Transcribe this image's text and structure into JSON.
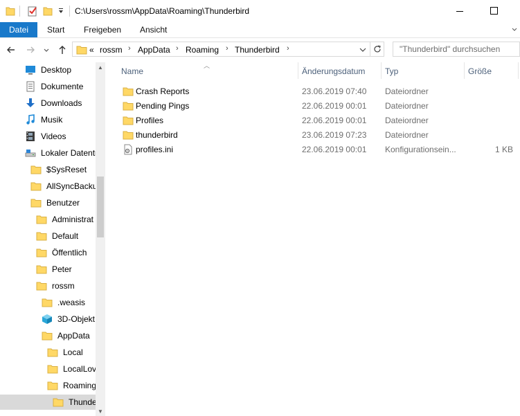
{
  "window": {
    "path": "C:\\Users\\rossm\\AppData\\Roaming\\Thunderbird"
  },
  "ribbon": {
    "tabs": [
      "Datei",
      "Start",
      "Freigeben",
      "Ansicht"
    ]
  },
  "address": {
    "overflow": "«",
    "crumbs": [
      "rossm",
      "AppData",
      "Roaming",
      "Thunderbird"
    ]
  },
  "search": {
    "placeholder": "\"Thunderbird\" durchsuchen"
  },
  "sidebar": {
    "items": [
      {
        "label": "Desktop",
        "icon": "desktop-icon"
      },
      {
        "label": "Dokumente",
        "icon": "documents-icon"
      },
      {
        "label": "Downloads",
        "icon": "download-arrow-icon"
      },
      {
        "label": "Musik",
        "icon": "music-note-icon"
      },
      {
        "label": "Videos",
        "icon": "film-icon"
      },
      {
        "label": "Lokaler Datentr",
        "icon": "drive-icon"
      },
      {
        "label": "$SysReset",
        "icon": "folder-icon"
      },
      {
        "label": "AllSyncBacku",
        "icon": "folder-icon"
      },
      {
        "label": "Benutzer",
        "icon": "folder-icon"
      },
      {
        "label": "Administrat",
        "icon": "folder-icon"
      },
      {
        "label": "Default",
        "icon": "folder-icon"
      },
      {
        "label": "Öffentlich",
        "icon": "folder-icon"
      },
      {
        "label": "Peter",
        "icon": "folder-icon"
      },
      {
        "label": "rossm",
        "icon": "folder-icon"
      },
      {
        "label": ".weasis",
        "icon": "folder-icon"
      },
      {
        "label": "3D-Objekt",
        "icon": "3d-objects-icon"
      },
      {
        "label": "AppData",
        "icon": "folder-icon"
      },
      {
        "label": "Local",
        "icon": "folder-icon"
      },
      {
        "label": "LocalLov",
        "icon": "folder-icon"
      },
      {
        "label": "Roaming",
        "icon": "folder-icon"
      },
      {
        "label": "Thunde",
        "icon": "folder-icon"
      }
    ]
  },
  "columns": {
    "name": "Name",
    "date": "Änderungsdatum",
    "type": "Typ",
    "size": "Größe"
  },
  "files": [
    {
      "name": "Crash Reports",
      "date": "23.06.2019 07:40",
      "type": "Dateiordner",
      "size": "",
      "icon": "folder-icon"
    },
    {
      "name": "Pending Pings",
      "date": "22.06.2019 00:01",
      "type": "Dateiordner",
      "size": "",
      "icon": "folder-icon"
    },
    {
      "name": "Profiles",
      "date": "22.06.2019 00:01",
      "type": "Dateiordner",
      "size": "",
      "icon": "folder-icon"
    },
    {
      "name": "thunderbird",
      "date": "23.06.2019 07:23",
      "type": "Dateiordner",
      "size": "",
      "icon": "folder-icon"
    },
    {
      "name": "profiles.ini",
      "date": "22.06.2019 00:01",
      "type": "Konfigurationsein...",
      "size": "1 KB",
      "icon": "settings-file-icon"
    }
  ],
  "colors": {
    "accent": "#1979ca",
    "folder": "#ffd866",
    "header_text": "#4c607a"
  }
}
